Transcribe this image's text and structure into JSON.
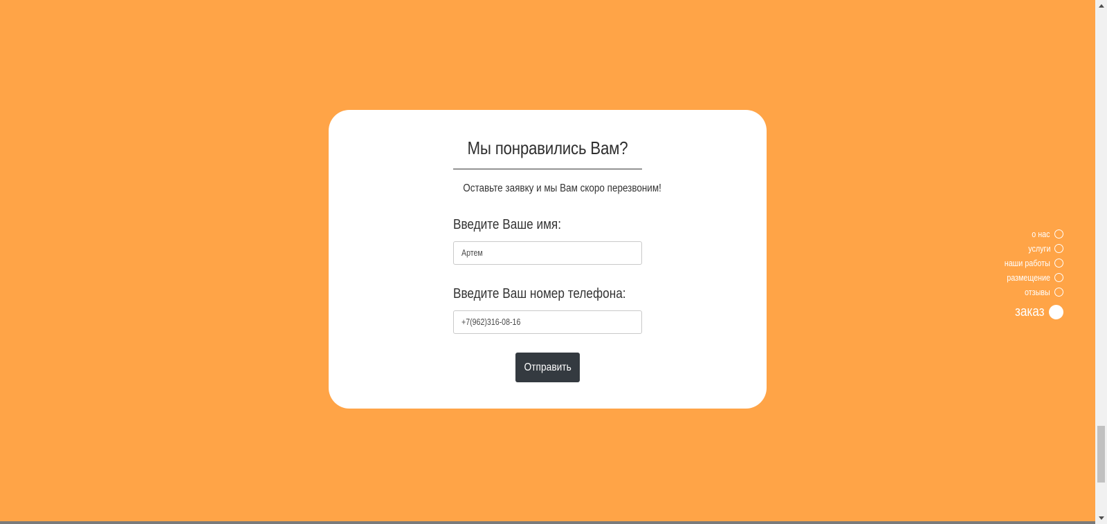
{
  "theme": {
    "background": "#ffa447",
    "card": "#ffffff",
    "button": "#343a40"
  },
  "form": {
    "title": "Мы понравились Вам?",
    "subtitle": "Оставьте заявку и мы Вам скоро перезвоним!",
    "name_label": "Введите Ваше имя:",
    "name_value": "Артем",
    "phone_label": "Введите Ваш номер телефона:",
    "phone_value": "+7(962)316-08-16",
    "submit_label": "Отправить"
  },
  "side_nav": {
    "items": [
      {
        "label": "о нас",
        "active": false
      },
      {
        "label": "услуги",
        "active": false
      },
      {
        "label": "наши работы",
        "active": false
      },
      {
        "label": "размещение",
        "active": false
      },
      {
        "label": "отзывы",
        "active": false
      },
      {
        "label": "заказ",
        "active": true
      }
    ]
  },
  "icons": {
    "scroll_up": "triangle-up-icon",
    "scroll_down": "triangle-down-icon",
    "nav_dot": "circle-icon"
  }
}
